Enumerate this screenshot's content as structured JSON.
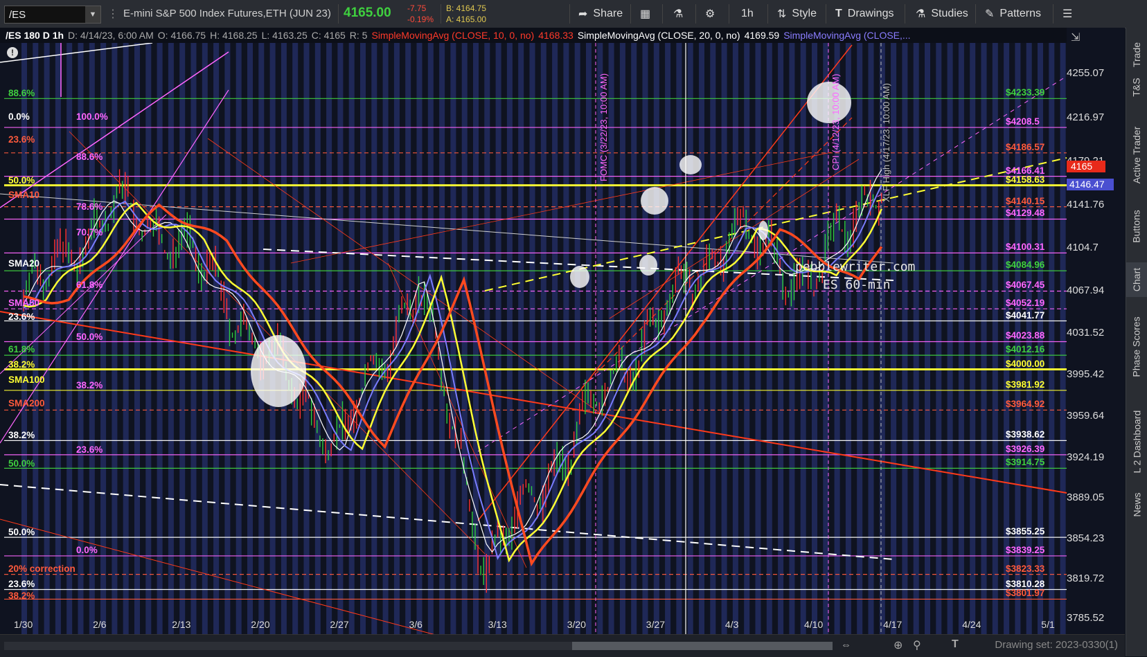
{
  "toolbar": {
    "symbol": "/ES",
    "description": "E-mini S&P 500 Index Futures,ETH (JUN 23)",
    "last": "4165.00",
    "change": "-7.75",
    "change_pct": "-0.19%",
    "bid": "B: 4164.75",
    "ask": "A: 4165.00",
    "share": "Share",
    "timeframe": "1h",
    "style": "Style",
    "drawings": "Drawings",
    "studies": "Studies",
    "patterns": "Patterns"
  },
  "info": {
    "title": "/ES 180 D 1h",
    "date": "D: 4/14/23, 6:00 AM",
    "open": "O: 4166.75",
    "high": "H: 4168.25",
    "low": "L: 4163.25",
    "close": "C: 4165",
    "range": "R: 5",
    "sma10": "SimpleMovingAvg (CLOSE, 10, 0, no)",
    "sma10_val": "4168.33",
    "sma20": "SimpleMovingAvg (CLOSE, 20, 0, no)",
    "sma20_val": "4169.59",
    "sma3": "SimpleMovingAvg (CLOSE,..."
  },
  "price_axis": [
    "4255.07",
    "4216.97",
    "4179.21",
    "4141.76",
    "4104.7",
    "4067.94",
    "4031.52",
    "3995.42",
    "3959.64",
    "3924.19",
    "3889.05",
    "3854.23",
    "3819.72",
    "3785.52"
  ],
  "price_tags": {
    "last": "4165",
    "sma": "4146.47"
  },
  "date_axis": [
    "1/30",
    "2/6",
    "2/13",
    "2/20",
    "2/27",
    "3/6",
    "3/13",
    "3/20",
    "3/27",
    "4/3",
    "4/10",
    "4/17",
    "4/24",
    "5/1"
  ],
  "levels_right": [
    {
      "text": "$4233.39",
      "color": "#3fd03f"
    },
    {
      "text": "$4208.5",
      "color": "#ff66ff"
    },
    {
      "text": "$4186.57",
      "color": "#ff5a3c"
    },
    {
      "text": "$4166.41",
      "color": "#ff66ff"
    },
    {
      "text": "$4158.63",
      "color": "#ffff33"
    },
    {
      "text": "$4140.15",
      "color": "#ff5a3c"
    },
    {
      "text": "$4129.48",
      "color": "#ff66ff"
    },
    {
      "text": "$4100.31",
      "color": "#ff66ff"
    },
    {
      "text": "$4084.96",
      "color": "#3fd03f"
    },
    {
      "text": "$4067.45",
      "color": "#ff66ff"
    },
    {
      "text": "$4052.19",
      "color": "#ff66ff"
    },
    {
      "text": "$4041.77",
      "color": "#ffffff"
    },
    {
      "text": "$4023.88",
      "color": "#ff66ff"
    },
    {
      "text": "$4012.16",
      "color": "#3fd03f"
    },
    {
      "text": "$4000.00",
      "color": "#ffff33"
    },
    {
      "text": "$3981.92",
      "color": "#ffff33"
    },
    {
      "text": "$3964.92",
      "color": "#ff5a3c"
    },
    {
      "text": "$3938.62",
      "color": "#ffffff"
    },
    {
      "text": "$3926.39",
      "color": "#ff66ff"
    },
    {
      "text": "$3914.75",
      "color": "#3fd03f"
    },
    {
      "text": "$3855.25",
      "color": "#ffffff"
    },
    {
      "text": "$3839.25",
      "color": "#ff66ff"
    },
    {
      "text": "$3823.33",
      "color": "#ff5a3c"
    },
    {
      "text": "$3810.28",
      "color": "#ffffff"
    },
    {
      "text": "$3801.97",
      "color": "#ff5a3c"
    }
  ],
  "levels_left": [
    {
      "text": "88.6%",
      "color": "#3fd03f"
    },
    {
      "text": "0.0%",
      "color": "#ffffff"
    },
    {
      "text": "100.0%",
      "color": "#ff66ff"
    },
    {
      "text": "23.6%",
      "color": "#ff5a3c"
    },
    {
      "text": "88.6%",
      "color": "#ff66ff"
    },
    {
      "text": "50.0%",
      "color": "#ffff33"
    },
    {
      "text": "SMA10",
      "color": "#ff5a3c"
    },
    {
      "text": "78.6%",
      "color": "#ff66ff"
    },
    {
      "text": "70.7%",
      "color": "#ff66ff"
    },
    {
      "text": "SMA20",
      "color": "#ffffff"
    },
    {
      "text": "61.8%",
      "color": "#ff66ff"
    },
    {
      "text": "SMA50",
      "color": "#ff66ff"
    },
    {
      "text": "23.6%",
      "color": "#ffffff"
    },
    {
      "text": "50.0%",
      "color": "#ff66ff"
    },
    {
      "text": "61.8%",
      "color": "#3fd03f"
    },
    {
      "text": "38.2%",
      "color": "#ffff33"
    },
    {
      "text": "SMA100",
      "color": "#ffff33"
    },
    {
      "text": "38.2%",
      "color": "#ff66ff"
    },
    {
      "text": "SMA200",
      "color": "#ff5a3c"
    },
    {
      "text": "38.2%",
      "color": "#ffffff"
    },
    {
      "text": "23.6%",
      "color": "#ff66ff"
    },
    {
      "text": "50.0%",
      "color": "#3fd03f"
    },
    {
      "text": "50.0%",
      "color": "#ffffff"
    },
    {
      "text": "0.0%",
      "color": "#ff66ff"
    },
    {
      "text": "20% correction",
      "color": "#ff5a3c"
    },
    {
      "text": "23.6%",
      "color": "#ffffff"
    },
    {
      "text": "38.2%",
      "color": "#ff5a3c"
    }
  ],
  "annotations": {
    "fomc": "FOMC (3/22/23, 10:00 AM)",
    "cpi": "CPI (4/12/23, 10:00 AM)",
    "xlf": "XLF High (4/17/23, 10:00 AM)",
    "watermark1": "pebblewriter.com",
    "watermark2": "ES 60-min"
  },
  "sidebar_tabs": [
    "Trade",
    "T&S",
    "Active Trader",
    "Buttons",
    "Chart",
    "Phase Scores",
    "Dashboard",
    "L 2",
    "News"
  ],
  "bottom": {
    "drawing_set": "Drawing set: 2023-0330(1)"
  },
  "colors": {
    "background": "#0f1320",
    "stripe": "#26306a",
    "sma10": "#ff4a1f",
    "sma20": "#ffff33",
    "sma50": "#7a7dff",
    "fib_pink": "#ff66ff",
    "green": "#3fd03f"
  }
}
